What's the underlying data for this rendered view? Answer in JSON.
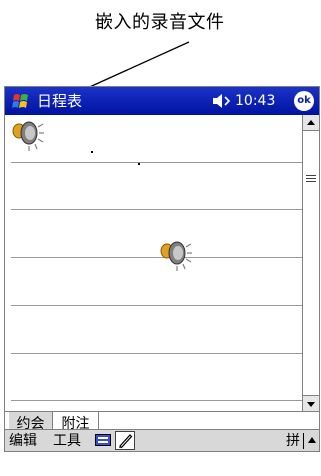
{
  "annotation": {
    "label": "嵌入的录音文件"
  },
  "titlebar": {
    "app_title": "日程表",
    "time": "10:43",
    "ok_label": "ok",
    "start_icon": "windows-flag-icon",
    "volume_icon": "speaker-volume-icon"
  },
  "content": {
    "recording_icon": "audio-recording-icon",
    "ruled_line_count": 6
  },
  "tabs": [
    {
      "label": "约会",
      "active": false
    },
    {
      "label": "附注",
      "active": true
    }
  ],
  "cmdbar": {
    "edit_label": "编辑",
    "tools_label": "工具",
    "keyboard_icon": "keyboard-icon",
    "pen_icon": "pen-icon",
    "ime_label": "拼",
    "ime_arrow_icon": "up-arrow-icon"
  },
  "colors": {
    "titlebar": "#0a1ea8",
    "bar_gray": "#d8d8d8"
  }
}
